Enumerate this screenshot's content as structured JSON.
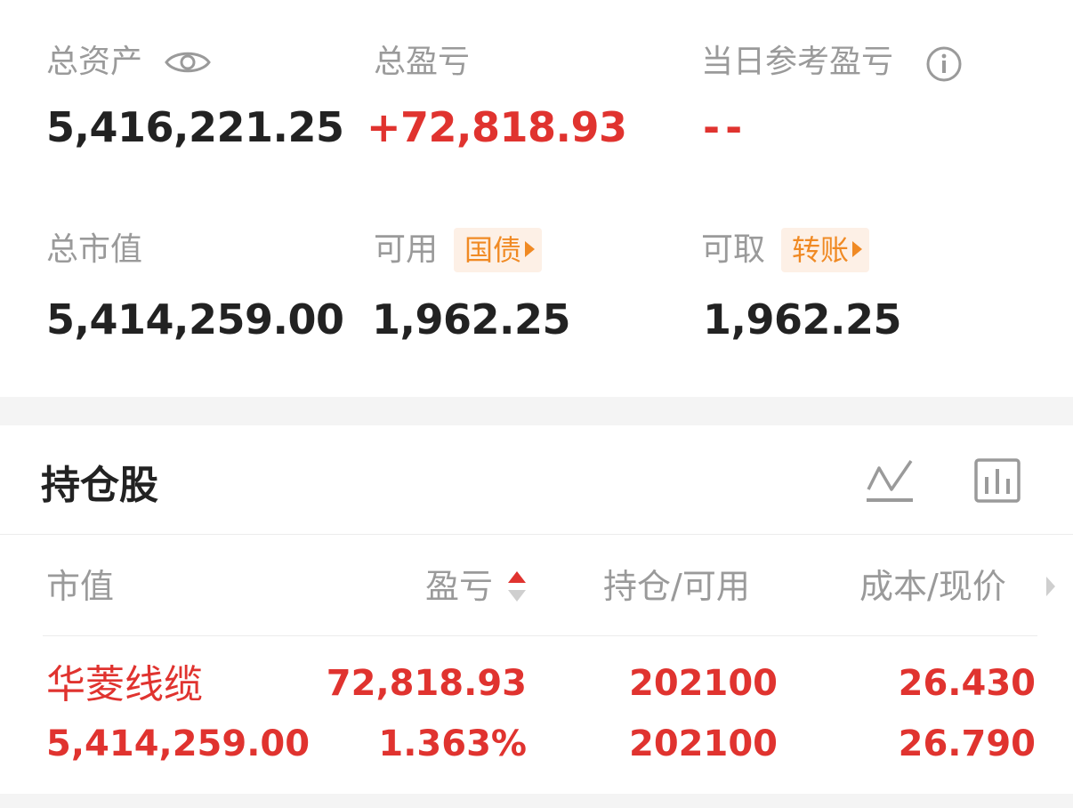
{
  "summary": {
    "total_assets": {
      "label": "总资产",
      "value": "5,416,221.25"
    },
    "total_pnl": {
      "label": "总盈亏",
      "value": "+72,818.93"
    },
    "daily_pnl": {
      "label": "当日参考盈亏",
      "value": "--"
    },
    "market_value": {
      "label": "总市值",
      "value": "5,414,259.00"
    },
    "available": {
      "label": "可用",
      "tag": "国债",
      "value": "1,962.25"
    },
    "withdrawable": {
      "label": "可取",
      "tag": "转账",
      "value": "1,962.25"
    }
  },
  "holdings": {
    "title": "持仓股",
    "columns": {
      "market_value": "市值",
      "pnl": "盈亏",
      "position_slash": "持仓",
      "sep1": "/",
      "available": "可用",
      "cost": "成本",
      "sep2": "/",
      "price": "现价"
    },
    "rows": [
      {
        "name": "华菱线缆",
        "market_value": "5,414,259.00",
        "pnl": "72,818.93",
        "pnl_pct": "1.363%",
        "position": "202100",
        "available": "202100",
        "cost": "26.430",
        "price": "26.790"
      }
    ]
  },
  "colors": {
    "up": "#e0332f",
    "tag_text": "#f08a24",
    "tag_bg": "#fdf0e6",
    "muted": "#9a9a9a"
  }
}
